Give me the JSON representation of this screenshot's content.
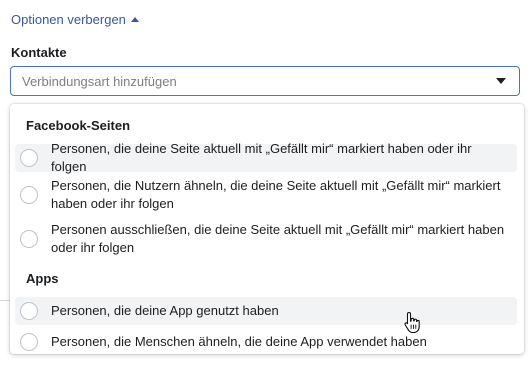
{
  "toggle": {
    "label": "Optionen verbergen",
    "icon": "caret-up-icon"
  },
  "contacts": {
    "label": "Kontakte",
    "select": {
      "placeholder": "Verbindungsart hinzufügen",
      "icon": "dropdown-arrow-icon"
    }
  },
  "menu": {
    "groups": [
      {
        "title": "Facebook-Seiten",
        "options": [
          {
            "label": "Personen, die deine Seite aktuell mit „Gefällt mir“ markiert haben oder ihr folgen",
            "highlighted": true
          },
          {
            "label": "Personen, die Nutzern ähneln, die deine Seite aktuell mit „Gefällt mir“ markiert haben oder ihr folgen",
            "highlighted": false
          },
          {
            "label": "Personen ausschließen, die deine Seite aktuell mit „Gefällt mir“ markiert haben oder ihr folgen",
            "highlighted": false
          }
        ]
      },
      {
        "title": "Apps",
        "options": [
          {
            "label": "Personen, die deine App genutzt haben",
            "highlighted": true
          },
          {
            "label": "Personen, die Menschen ähneln, die deine App verwendet haben",
            "highlighted": false
          }
        ]
      }
    ]
  },
  "colors": {
    "link": "#385898",
    "focus_border": "#4a76c3",
    "highlight": "#f2f3f5"
  }
}
